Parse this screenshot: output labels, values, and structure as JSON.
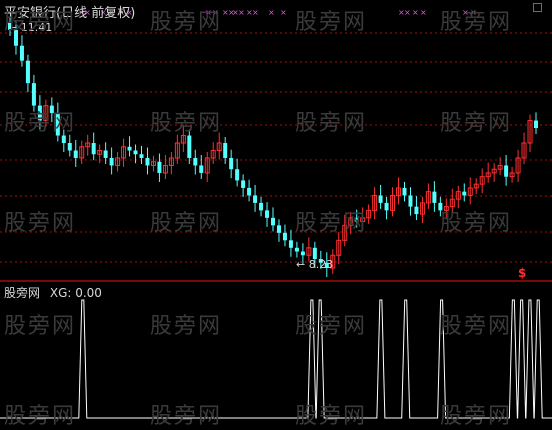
{
  "main_chart": {
    "title": "平安银行(日线 前复权)",
    "high_label": "11.41",
    "low_label": "8.23",
    "signal_symbol": "$"
  },
  "indicator": {
    "title": "股旁网",
    "value_label": "XG: 0.00"
  },
  "watermark_text": "股旁网",
  "colors": {
    "background": "#000000",
    "up_candle": "#ff3030",
    "down_candle": "#54ffff",
    "grid": "#a01010",
    "separator": "#c01010",
    "signal_line": "#ffffff",
    "marker": "#ff40ff"
  },
  "chart_data": {
    "type": "candlestick",
    "price_range": [
      8.23,
      11.41
    ],
    "closes": [
      11.41,
      11.2,
      11.0,
      10.7,
      10.4,
      10.2,
      10.4,
      10.3,
      10.0,
      9.9,
      9.8,
      9.7,
      9.85,
      9.9,
      9.75,
      9.8,
      9.7,
      9.6,
      9.7,
      9.85,
      9.8,
      9.75,
      9.7,
      9.6,
      9.65,
      9.5,
      9.6,
      9.7,
      9.9,
      10.0,
      9.7,
      9.6,
      9.5,
      9.7,
      9.8,
      9.9,
      9.7,
      9.55,
      9.4,
      9.3,
      9.2,
      9.1,
      9.0,
      8.9,
      8.8,
      8.7,
      8.6,
      8.5,
      8.45,
      8.4,
      8.5,
      8.35,
      8.3,
      8.23,
      8.4,
      8.6,
      8.8,
      8.9,
      8.85,
      8.9,
      9.0,
      9.2,
      9.1,
      9.0,
      9.2,
      9.3,
      9.2,
      9.05,
      8.95,
      9.1,
      9.25,
      9.1,
      9.0,
      9.05,
      9.15,
      9.25,
      9.2,
      9.3,
      9.35,
      9.45,
      9.5,
      9.55,
      9.6,
      9.45,
      9.5,
      9.7,
      9.9,
      10.2,
      10.1
    ],
    "signal": [
      0,
      0,
      0,
      0,
      0,
      0,
      0,
      0,
      0,
      0,
      0,
      0,
      0,
      0,
      0,
      0,
      0,
      0,
      0,
      0,
      0,
      0,
      0,
      0,
      0,
      0,
      0,
      0,
      0,
      0,
      0,
      0,
      0,
      0,
      0,
      0,
      0,
      0,
      0,
      0,
      0,
      0,
      0,
      0,
      0,
      0,
      0,
      0,
      0,
      0,
      0,
      0,
      0,
      0,
      0,
      0,
      0,
      0,
      0,
      0,
      0,
      0,
      0,
      0,
      0,
      0,
      0,
      0,
      0,
      0,
      0,
      0,
      0,
      0,
      0,
      0,
      0,
      0,
      0,
      0,
      0,
      0,
      0,
      0,
      0,
      0,
      0,
      0,
      0
    ],
    "signal_peaks": [
      0.15,
      0.565,
      0.58,
      0.69,
      0.735,
      0.8,
      0.93,
      0.945,
      0.96,
      0.975
    ]
  }
}
